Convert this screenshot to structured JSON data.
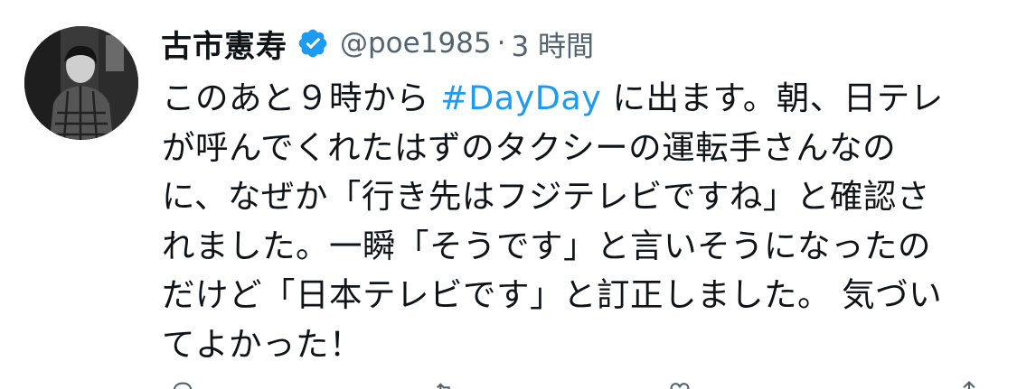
{
  "tweet": {
    "author": {
      "display_name": "古市憲寿",
      "handle": "@poe1985",
      "verified": true
    },
    "separator": "·",
    "timestamp": "3 時間",
    "text": {
      "line1_before": "このあと９時から ",
      "hashtag": "#DayDay",
      "line1_after": " に出ます。朝、日テレ",
      "line2": "が呼んでくれたはずのタクシーの運転手さんなの",
      "line3": "に、なぜか「行き先はフジテレビですね」と確認さ",
      "line4": "れました。一瞬「そうです」と言いそうになったの",
      "line5": "だけど「日本テレビです」と訂正しました。 気づい",
      "line6": "てよかった！"
    }
  },
  "colors": {
    "primary_text": "#0f1419",
    "secondary_text": "#536471",
    "accent": "#1d9bf0"
  },
  "icons": {
    "verified": "verified-badge-icon",
    "actions": [
      "reply-icon",
      "retweet-icon",
      "like-icon",
      "share-icon"
    ]
  }
}
